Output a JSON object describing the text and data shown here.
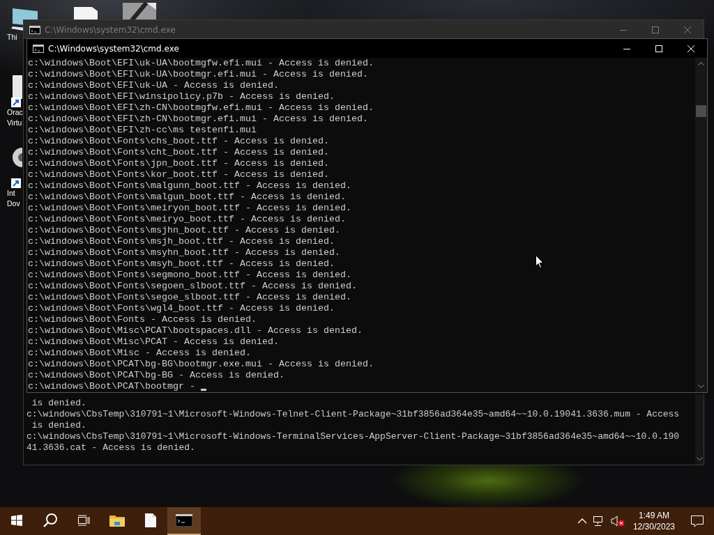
{
  "desktop_icons": [
    {
      "kind": "computer",
      "lines": [
        "Thi"
      ]
    },
    {
      "kind": "document"
    },
    {
      "kind": "image"
    },
    {
      "kind": "box-shortcut",
      "lines": [
        "Orac",
        "Virtu"
      ]
    },
    {
      "kind": "disc-shortcut",
      "lines": [
        "Int",
        "Dov"
      ]
    }
  ],
  "windows": [
    {
      "title": "C:\\Windows\\system32\\cmd.exe",
      "active": false,
      "lines": [
        " is denied.",
        "c:\\windows\\CbsTemp\\310791~1\\Microsoft-Windows-Telnet-Client-Package~31bf3856ad364e35~amd64~~10.0.19041.3636.mum - Access",
        " is denied.",
        "c:\\windows\\CbsTemp\\310791~1\\Microsoft-Windows-TerminalServices-AppServer-Client-Package~31bf3856ad364e35~amd64~~10.0.190",
        "41.3636.cat - Access is denied."
      ]
    },
    {
      "title": "C:\\Windows\\system32\\cmd.exe",
      "active": true,
      "lines": [
        "c:\\windows\\Boot\\EFI\\uk-UA\\bootmgfw.efi.mui - Access is denied.",
        "c:\\windows\\Boot\\EFI\\uk-UA\\bootmgr.efi.mui - Access is denied.",
        "c:\\windows\\Boot\\EFI\\uk-UA - Access is denied.",
        "c:\\windows\\Boot\\EFI\\winsipolicy.p7b - Access is denied.",
        "c:\\windows\\Boot\\EFI\\zh-CN\\bootmgfw.efi.mui - Access is denied.",
        "c:\\windows\\Boot\\EFI\\zh-CN\\bootmgr.efi.mui - Access is denied.",
        "c:\\windows\\Boot\\EFI\\zh-cc\\ms testenfi.mui",
        "c:\\windows\\Boot\\Fonts\\chs_boot.ttf - Access is denied.",
        "c:\\windows\\Boot\\Fonts\\cht_boot.ttf - Access is denied.",
        "c:\\windows\\Boot\\Fonts\\jpn_boot.ttf - Access is denied.",
        "c:\\windows\\Boot\\Fonts\\kor_boot.ttf - Access is denied.",
        "c:\\windows\\Boot\\Fonts\\malgunn_boot.ttf - Access is denied.",
        "c:\\windows\\Boot\\Fonts\\malgun_boot.ttf - Access is denied.",
        "c:\\windows\\Boot\\Fonts\\meiryon_boot.ttf - Access is denied.",
        "c:\\windows\\Boot\\Fonts\\meiryo_boot.ttf - Access is denied.",
        "c:\\windows\\Boot\\Fonts\\msjhn_boot.ttf - Access is denied.",
        "c:\\windows\\Boot\\Fonts\\msjh_boot.ttf - Access is denied.",
        "c:\\windows\\Boot\\Fonts\\msyhn_boot.ttf - Access is denied.",
        "c:\\windows\\Boot\\Fonts\\msyh_boot.ttf - Access is denied.",
        "c:\\windows\\Boot\\Fonts\\segmono_boot.ttf - Access is denied.",
        "c:\\windows\\Boot\\Fonts\\segoen_slboot.ttf - Access is denied.",
        "c:\\windows\\Boot\\Fonts\\segoe_slboot.ttf - Access is denied.",
        "c:\\windows\\Boot\\Fonts\\wgl4_boot.ttf - Access is denied.",
        "c:\\windows\\Boot\\Fonts - Access is denied.",
        "c:\\windows\\Boot\\Misc\\PCAT\\bootspaces.dll - Access is denied.",
        "c:\\windows\\Boot\\Misc\\PCAT - Access is denied.",
        "c:\\windows\\Boot\\Misc - Access is denied.",
        "c:\\windows\\Boot\\PCAT\\bg-BG\\bootmgr.exe.mui - Access is denied.",
        "c:\\windows\\Boot\\PCAT\\bg-BG - Access is denied.",
        "c:\\windows\\Boot\\PCAT\\bootmgr - "
      ]
    }
  ],
  "taskbar": {
    "apps": [
      {
        "kind": "start",
        "selected": false
      },
      {
        "kind": "search",
        "selected": false
      },
      {
        "kind": "task-view",
        "selected": false
      },
      {
        "kind": "file-explorer",
        "selected": false
      },
      {
        "kind": "file",
        "selected": false
      },
      {
        "kind": "console",
        "selected": true
      }
    ],
    "tray": {
      "volume_muted": true,
      "time": "1:49 AM",
      "date": "12/30/2023"
    }
  }
}
